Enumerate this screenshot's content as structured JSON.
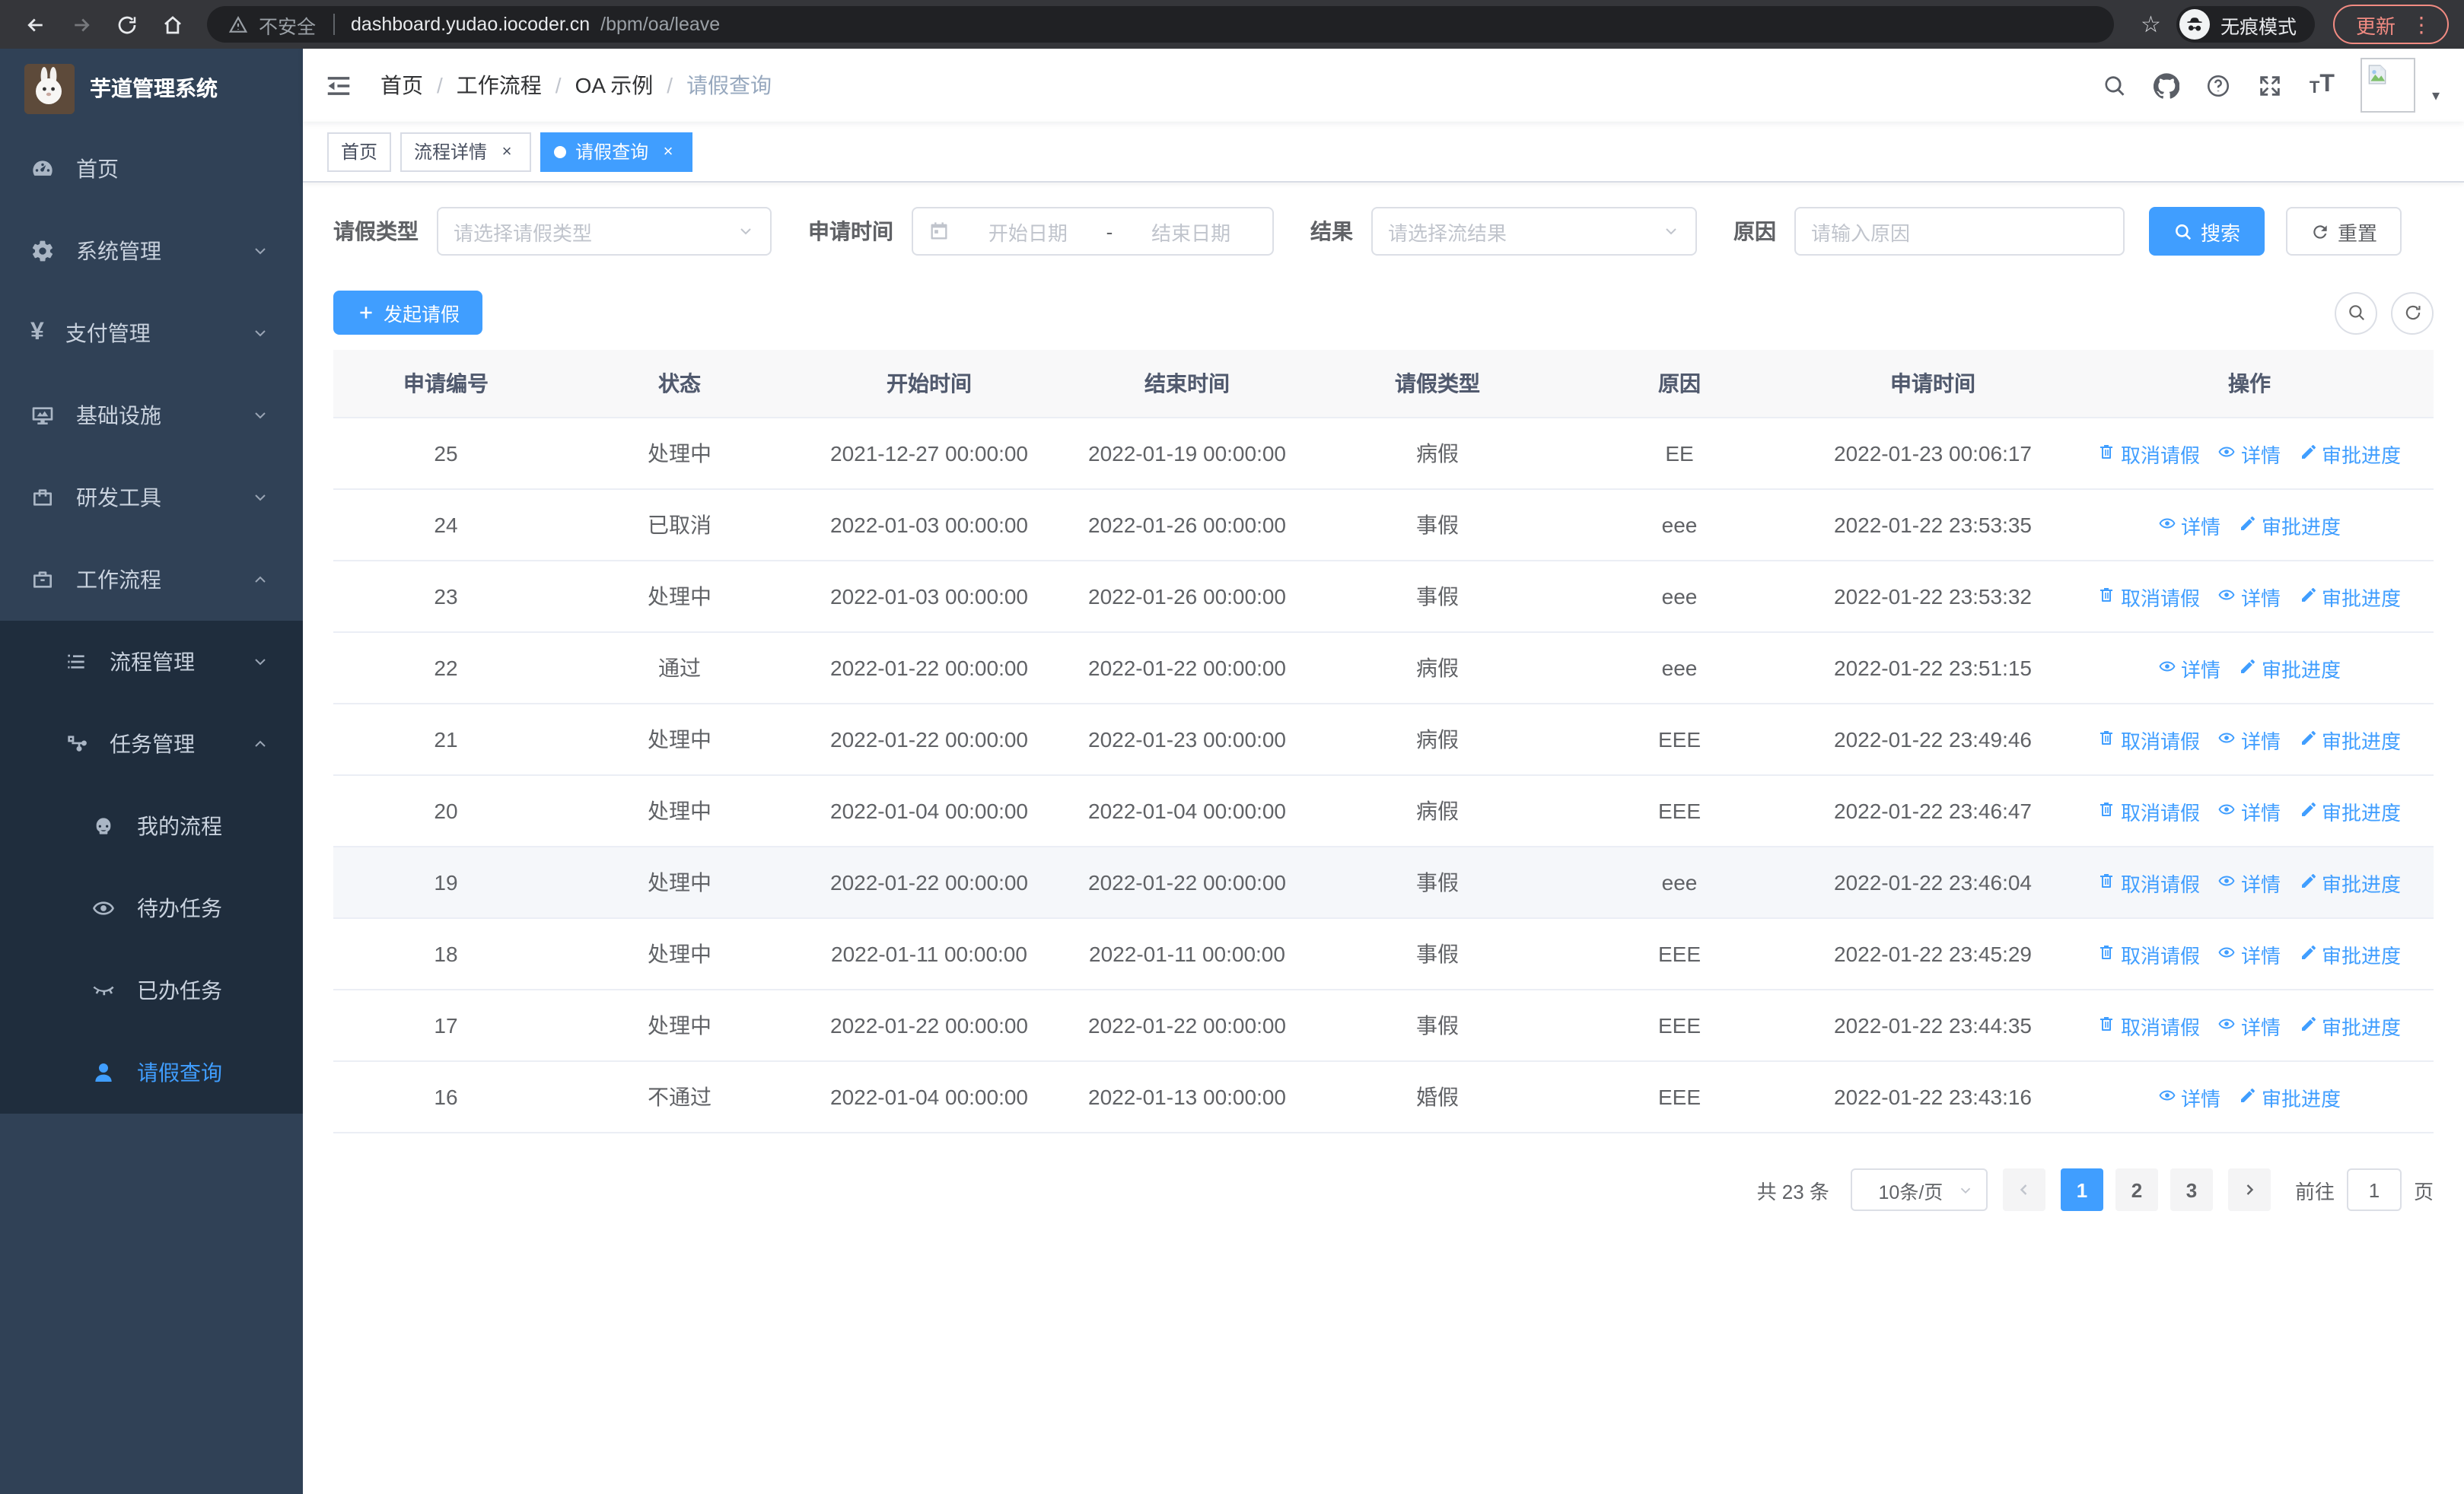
{
  "browser": {
    "security_label": "不安全",
    "url_host": "dashboard.yudao.iocoder.cn",
    "url_path": "/bpm/oa/leave",
    "incognito_label": "无痕模式",
    "update_label": "更新"
  },
  "app_title": "芋道管理系统",
  "sidebar": {
    "items": [
      {
        "label": "首页",
        "icon": "dashboard-icon",
        "level": 1
      },
      {
        "label": "系统管理",
        "icon": "gear-icon",
        "level": 1,
        "arrow": "down"
      },
      {
        "label": "支付管理",
        "icon": "yen-icon",
        "level": 1,
        "arrow": "down"
      },
      {
        "label": "基础设施",
        "icon": "monitor-icon",
        "level": 1,
        "arrow": "down"
      },
      {
        "label": "研发工具",
        "icon": "toolbox-icon",
        "level": 1,
        "arrow": "down"
      },
      {
        "label": "工作流程",
        "icon": "briefcase-icon",
        "level": 1,
        "arrow": "up"
      },
      {
        "label": "流程管理",
        "icon": "tree-list-icon",
        "level": 2,
        "arrow": "down",
        "submenu": true
      },
      {
        "label": "任务管理",
        "icon": "flow-icon",
        "level": 2,
        "arrow": "up",
        "submenu": true
      },
      {
        "label": "我的流程",
        "icon": "robot-icon",
        "level": 3,
        "submenu": true
      },
      {
        "label": "待办任务",
        "icon": "eye-open-icon",
        "level": 3,
        "submenu": true
      },
      {
        "label": "已办任务",
        "icon": "eye-closed-icon",
        "level": 3,
        "submenu": true
      },
      {
        "label": "请假查询",
        "icon": "user-icon",
        "level": 3,
        "submenu": true,
        "active": true
      }
    ]
  },
  "breadcrumb": [
    "首页",
    "工作流程",
    "OA 示例",
    "请假查询"
  ],
  "tabs": [
    {
      "label": "首页",
      "closable": false,
      "active": false
    },
    {
      "label": "流程详情",
      "closable": true,
      "active": false
    },
    {
      "label": "请假查询",
      "closable": true,
      "active": true
    }
  ],
  "filters": {
    "type_label": "请假类型",
    "type_placeholder": "请选择请假类型",
    "time_label": "申请时间",
    "start_placeholder": "开始日期",
    "range_separator": "-",
    "end_placeholder": "结束日期",
    "result_label": "结果",
    "result_placeholder": "请选择流结果",
    "reason_label": "原因",
    "reason_placeholder": "请输入原因",
    "search_label": "搜索",
    "reset_label": "重置"
  },
  "actions_bar": {
    "create_label": "发起请假"
  },
  "table": {
    "headers": [
      "申请编号",
      "状态",
      "开始时间",
      "结束时间",
      "请假类型",
      "原因",
      "申请时间",
      "操作"
    ],
    "action_labels": {
      "cancel": "取消请假",
      "detail": "详情",
      "progress": "审批进度"
    },
    "rows": [
      {
        "id": "25",
        "status": "处理中",
        "start": "2021-12-27 00:00:00",
        "end": "2022-01-19 00:00:00",
        "type": "病假",
        "reason": "EE",
        "applied": "2022-01-23 00:06:17",
        "actions": [
          "cancel",
          "detail",
          "progress"
        ]
      },
      {
        "id": "24",
        "status": "已取消",
        "start": "2022-01-03 00:00:00",
        "end": "2022-01-26 00:00:00",
        "type": "事假",
        "reason": "eee",
        "applied": "2022-01-22 23:53:35",
        "actions": [
          "detail",
          "progress"
        ]
      },
      {
        "id": "23",
        "status": "处理中",
        "start": "2022-01-03 00:00:00",
        "end": "2022-01-26 00:00:00",
        "type": "事假",
        "reason": "eee",
        "applied": "2022-01-22 23:53:32",
        "actions": [
          "cancel",
          "detail",
          "progress"
        ]
      },
      {
        "id": "22",
        "status": "通过",
        "start": "2022-01-22 00:00:00",
        "end": "2022-01-22 00:00:00",
        "type": "病假",
        "reason": "eee",
        "applied": "2022-01-22 23:51:15",
        "actions": [
          "detail",
          "progress"
        ]
      },
      {
        "id": "21",
        "status": "处理中",
        "start": "2022-01-22 00:00:00",
        "end": "2022-01-23 00:00:00",
        "type": "病假",
        "reason": "EEE",
        "applied": "2022-01-22 23:49:46",
        "actions": [
          "cancel",
          "detail",
          "progress"
        ]
      },
      {
        "id": "20",
        "status": "处理中",
        "start": "2022-01-04 00:00:00",
        "end": "2022-01-04 00:00:00",
        "type": "病假",
        "reason": "EEE",
        "applied": "2022-01-22 23:46:47",
        "actions": [
          "cancel",
          "detail",
          "progress"
        ]
      },
      {
        "id": "19",
        "status": "处理中",
        "start": "2022-01-22 00:00:00",
        "end": "2022-01-22 00:00:00",
        "type": "事假",
        "reason": "eee",
        "applied": "2022-01-22 23:46:04",
        "actions": [
          "cancel",
          "detail",
          "progress"
        ],
        "hover": true
      },
      {
        "id": "18",
        "status": "处理中",
        "start": "2022-01-11 00:00:00",
        "end": "2022-01-11 00:00:00",
        "type": "事假",
        "reason": "EEE",
        "applied": "2022-01-22 23:45:29",
        "actions": [
          "cancel",
          "detail",
          "progress"
        ]
      },
      {
        "id": "17",
        "status": "处理中",
        "start": "2022-01-22 00:00:00",
        "end": "2022-01-22 00:00:00",
        "type": "事假",
        "reason": "EEE",
        "applied": "2022-01-22 23:44:35",
        "actions": [
          "cancel",
          "detail",
          "progress"
        ]
      },
      {
        "id": "16",
        "status": "不通过",
        "start": "2022-01-04 00:00:00",
        "end": "2022-01-13 00:00:00",
        "type": "婚假",
        "reason": "EEE",
        "applied": "2022-01-22 23:43:16",
        "actions": [
          "detail",
          "progress"
        ]
      }
    ]
  },
  "pagination": {
    "total": "共 23 条",
    "page_size": "10条/页",
    "pages": [
      "1",
      "2",
      "3"
    ],
    "active_page": "1",
    "goto_label": "前往",
    "goto_value": "1",
    "page_suffix": "页"
  },
  "colors": {
    "primary": "#409eff",
    "sidebar_bg": "#304156",
    "submenu_bg": "#1f2d3d",
    "update_accent": "#f28b82"
  }
}
